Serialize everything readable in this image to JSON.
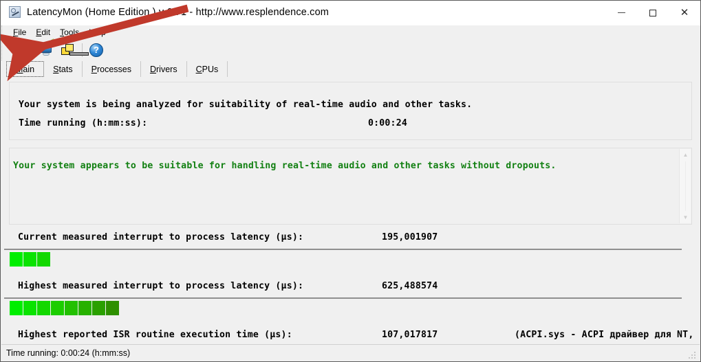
{
  "window": {
    "title": "LatencyMon  (Home Edition )  v 6.71 - http://www.resplendence.com",
    "app_icon": "magnifier-monitor-icon",
    "controls": {
      "minimize": "—",
      "maximize": "□",
      "close": "✕"
    }
  },
  "menu": {
    "items": [
      {
        "mnemonic": "F",
        "rest": "ile"
      },
      {
        "mnemonic": "E",
        "rest": "dit"
      },
      {
        "mnemonic": "T",
        "rest": "ools"
      },
      {
        "mnemonic": "H",
        "rest": "elp"
      }
    ]
  },
  "toolbar": {
    "buttons": [
      {
        "name": "start-monitoring-button",
        "icon": "play-triangle-icon",
        "enabled": false
      },
      {
        "name": "report-button",
        "icon": "monitor-pen-icon",
        "enabled": true
      },
      {
        "name": "windows-copy-button",
        "icon": "yellow-windows-icon",
        "enabled": true
      },
      {
        "name": "help-button",
        "icon": "question-mark-icon",
        "glyph": "?",
        "enabled": true
      }
    ]
  },
  "tabs": [
    {
      "mnemonic": "M",
      "rest": "ain",
      "active": true
    },
    {
      "mnemonic": "S",
      "rest": "tats",
      "active": false
    },
    {
      "mnemonic": "P",
      "rest": "rocesses",
      "active": false
    },
    {
      "mnemonic": "D",
      "rest": "rivers",
      "active": false
    },
    {
      "mnemonic": "C",
      "rest": "PUs",
      "active": false
    }
  ],
  "main": {
    "analyzing_line": "Your system is being analyzed for suitability of real-time audio and other tasks.",
    "time_running_label": "Time running (h:mm:ss):",
    "time_running_value": "0:00:24",
    "verdict_text": "Your system appears to be suitable for handling real-time audio and other tasks without dropouts.",
    "verdict_color": "#128012",
    "rows": [
      {
        "name": "current-measured-latency",
        "label": "Current measured interrupt to process latency (µs):",
        "value": "195,001907",
        "extra": "",
        "bar_segments": 3
      },
      {
        "name": "highest-measured-latency",
        "label": "Highest measured interrupt to process latency (µs):",
        "value": "625,488574",
        "extra": "",
        "bar_segments": 8
      },
      {
        "name": "highest-reported-isr",
        "label": "Highest reported ISR routine execution time (µs):",
        "value": "107,017817",
        "extra": "(ACPI.sys - ACPI драйвер для NT, Micros",
        "bar_segments": 0
      }
    ],
    "bar_colors": [
      "#00ee00",
      "#0ae300",
      "#13d800",
      "#1ccd00",
      "#22c000",
      "#27b100",
      "#2aa000",
      "#2e9000"
    ],
    "scrollbar": {
      "up_arrow": "▲",
      "down_arrow": "▼"
    }
  },
  "statusbar": {
    "text": "Time running: 0:00:24  (h:mm:ss)"
  },
  "annotation": {
    "arrow_color": "#c0392b",
    "description": "red-arrow-pointing-to-start-monitoring-button"
  }
}
